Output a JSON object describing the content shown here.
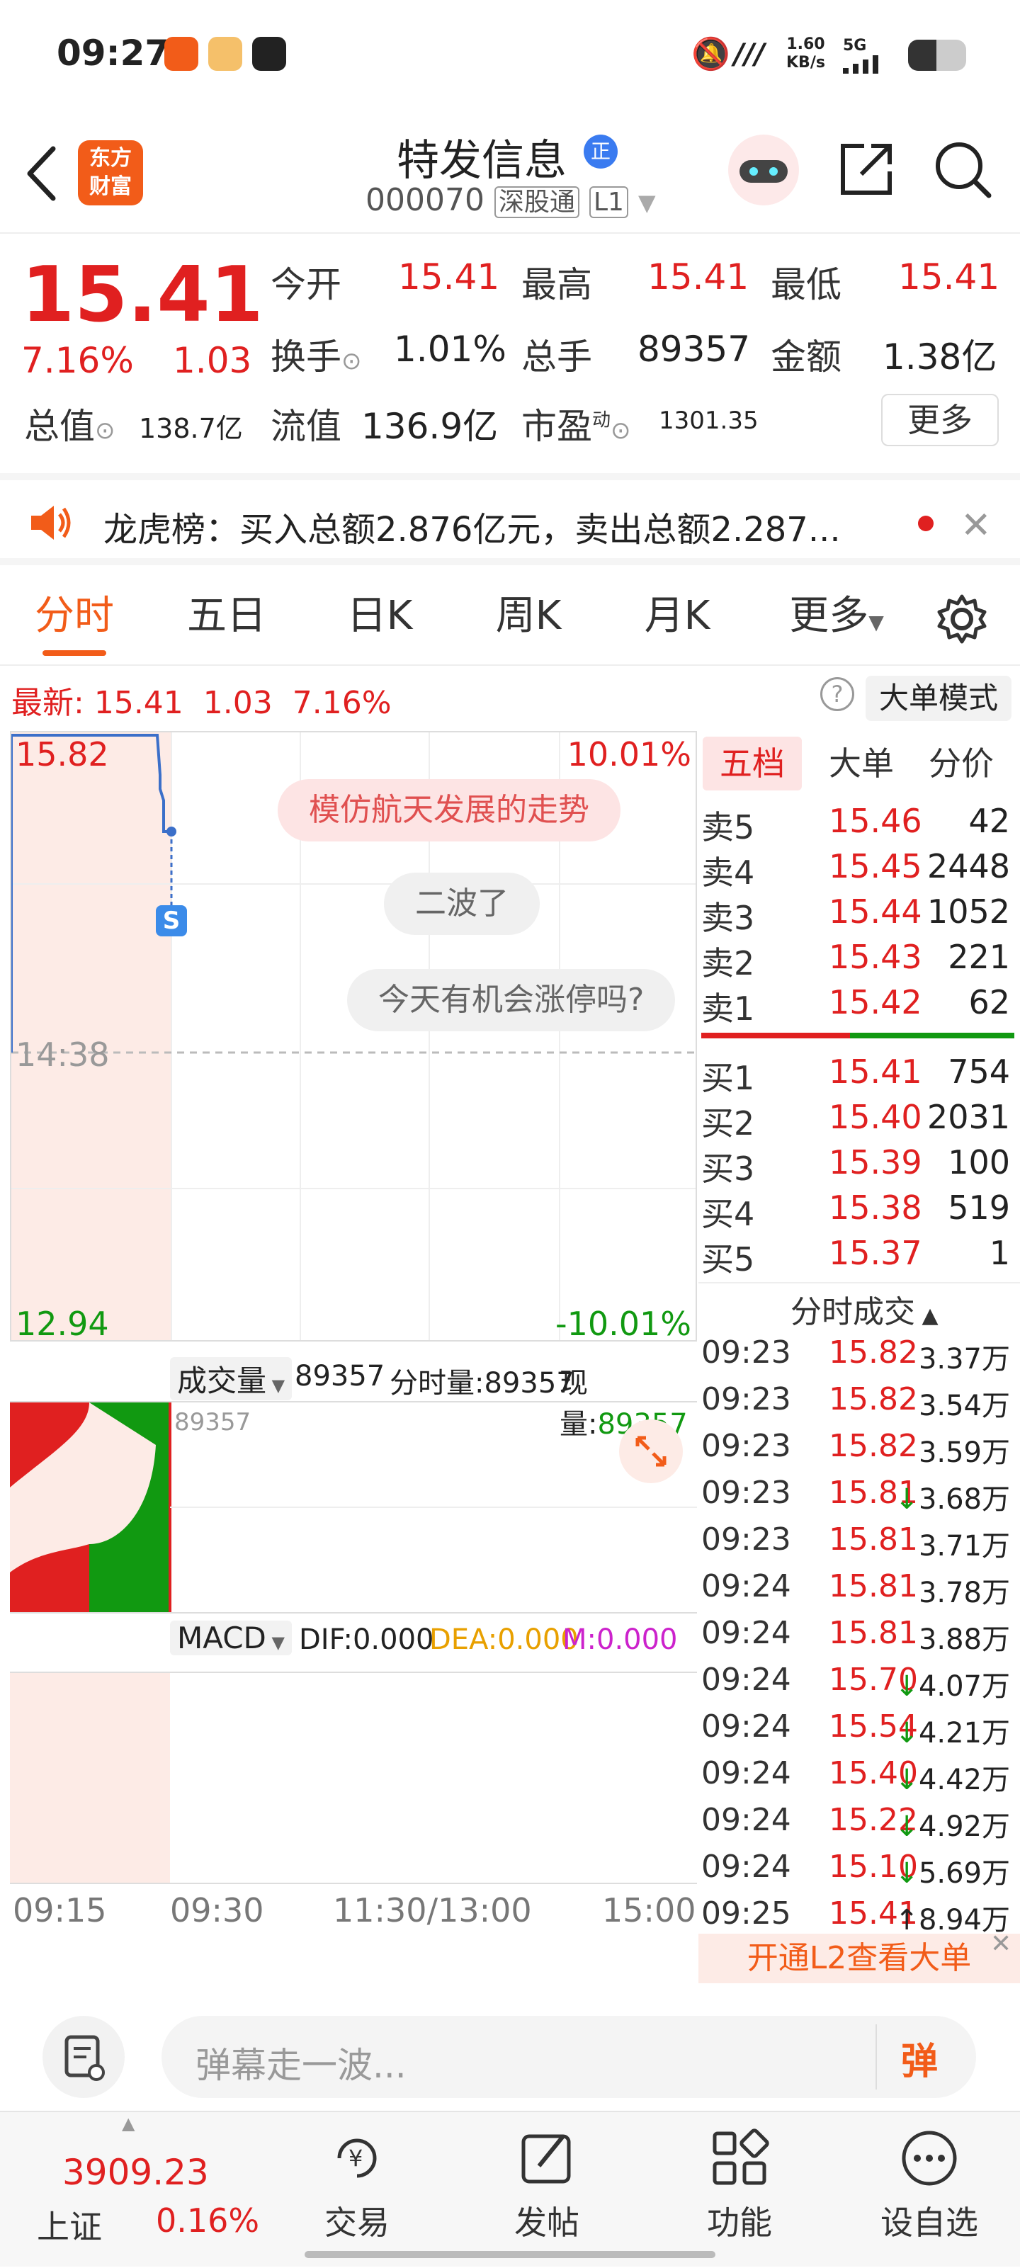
{
  "status_bar": {
    "time": "09:27",
    "net_speed": "1.60",
    "net_unit": "KB/s",
    "signal": "5G"
  },
  "header": {
    "title": "特发信息",
    "code": "000070",
    "exchange_tag": "深股通",
    "level_tag": "L1",
    "brand_line1": "东方",
    "brand_line2": "财富"
  },
  "quote": {
    "price": "15.41",
    "change_pct": "7.16%",
    "change": "1.03",
    "open_label": "今开",
    "open": "15.41",
    "high_label": "最高",
    "high": "15.41",
    "low_label": "最低",
    "low": "15.41",
    "turnover_label": "换手",
    "turnover": "1.01%",
    "volume_label": "总手",
    "volume": "89357",
    "amount_label": "金额",
    "amount": "1.38亿",
    "mktcap_label": "总值",
    "mktcap": "138.7亿",
    "float_label": "流值",
    "float": "136.9亿",
    "pe_label": "市盈",
    "pe_sup": "动",
    "pe": "1301.35",
    "more_button": "更多"
  },
  "notice": {
    "text": "龙虎榜：买入总额2.876亿元，卖出总额2.287..."
  },
  "tabs": [
    "分时",
    "五日",
    "日K",
    "周K",
    "月K",
    "更多"
  ],
  "latest": {
    "label": "最新:",
    "price": "15.41",
    "change": "1.03",
    "pct": "7.16%",
    "mode_button": "大单模式"
  },
  "chart": {
    "top_price": "15.82",
    "top_pct": "10.01%",
    "mid_time": "14:38",
    "bottom_price": "12.94",
    "bottom_pct": "-10.01%",
    "bubbles": [
      "模仿航天发展的走势",
      "二波了",
      "今天有机会涨停吗?"
    ],
    "marker": "S",
    "volume_label": "成交量",
    "volume_total": "89357",
    "volume_fen_label": "分时量:89357",
    "volume_now_label": "现量:",
    "volume_now": "89357",
    "volume_axis": "89357",
    "macd_label": "MACD",
    "dif": "DIF:0.000",
    "dea": "DEA:0.000",
    "m": "M:0.000",
    "x_labels": [
      "09:15",
      "09:30",
      "11:30/13:00",
      "15:00"
    ]
  },
  "orderbook": {
    "tabs": [
      "五档",
      "大单",
      "分价"
    ],
    "asks": [
      {
        "label": "卖5",
        "price": "15.46",
        "vol": "42"
      },
      {
        "label": "卖4",
        "price": "15.45",
        "vol": "2448"
      },
      {
        "label": "卖3",
        "price": "15.44",
        "vol": "1052"
      },
      {
        "label": "卖2",
        "price": "15.43",
        "vol": "221"
      },
      {
        "label": "卖1",
        "price": "15.42",
        "vol": "62"
      }
    ],
    "bids": [
      {
        "label": "买1",
        "price": "15.41",
        "vol": "754"
      },
      {
        "label": "买2",
        "price": "15.40",
        "vol": "2031"
      },
      {
        "label": "买3",
        "price": "15.39",
        "vol": "100"
      },
      {
        "label": "买4",
        "price": "15.38",
        "vol": "519"
      },
      {
        "label": "买5",
        "price": "15.37",
        "vol": "1"
      }
    ]
  },
  "ticks": {
    "header": "分时成交",
    "rows": [
      {
        "time": "09:23",
        "price": "15.82",
        "arrow": "",
        "vol": "3.37万"
      },
      {
        "time": "09:23",
        "price": "15.82",
        "arrow": "",
        "vol": "3.54万"
      },
      {
        "time": "09:23",
        "price": "15.82",
        "arrow": "",
        "vol": "3.59万"
      },
      {
        "time": "09:23",
        "price": "15.81",
        "arrow": "↓",
        "vol": "3.68万"
      },
      {
        "time": "09:23",
        "price": "15.81",
        "arrow": "",
        "vol": "3.71万"
      },
      {
        "time": "09:24",
        "price": "15.81",
        "arrow": "",
        "vol": "3.78万"
      },
      {
        "time": "09:24",
        "price": "15.81",
        "arrow": "",
        "vol": "3.88万"
      },
      {
        "time": "09:24",
        "price": "15.70",
        "arrow": "↓",
        "vol": "4.07万"
      },
      {
        "time": "09:24",
        "price": "15.54",
        "arrow": "↓",
        "vol": "4.21万"
      },
      {
        "time": "09:24",
        "price": "15.40",
        "arrow": "↓",
        "vol": "4.42万"
      },
      {
        "time": "09:24",
        "price": "15.22",
        "arrow": "↓",
        "vol": "4.92万"
      },
      {
        "time": "09:24",
        "price": "15.10",
        "arrow": "↓",
        "vol": "5.69万"
      },
      {
        "time": "09:25",
        "price": "15.41",
        "arrow": "↑",
        "vol": "8.94万"
      }
    ],
    "l2_banner": "开通L2查看大单"
  },
  "comment": {
    "placeholder": "弹幕走一波...",
    "send_label": "弹"
  },
  "bottom": {
    "index_value": "3909.23",
    "index_name": "上证",
    "index_pct": "0.16%",
    "nav": [
      "交易",
      "发帖",
      "功能",
      "设自选"
    ]
  }
}
